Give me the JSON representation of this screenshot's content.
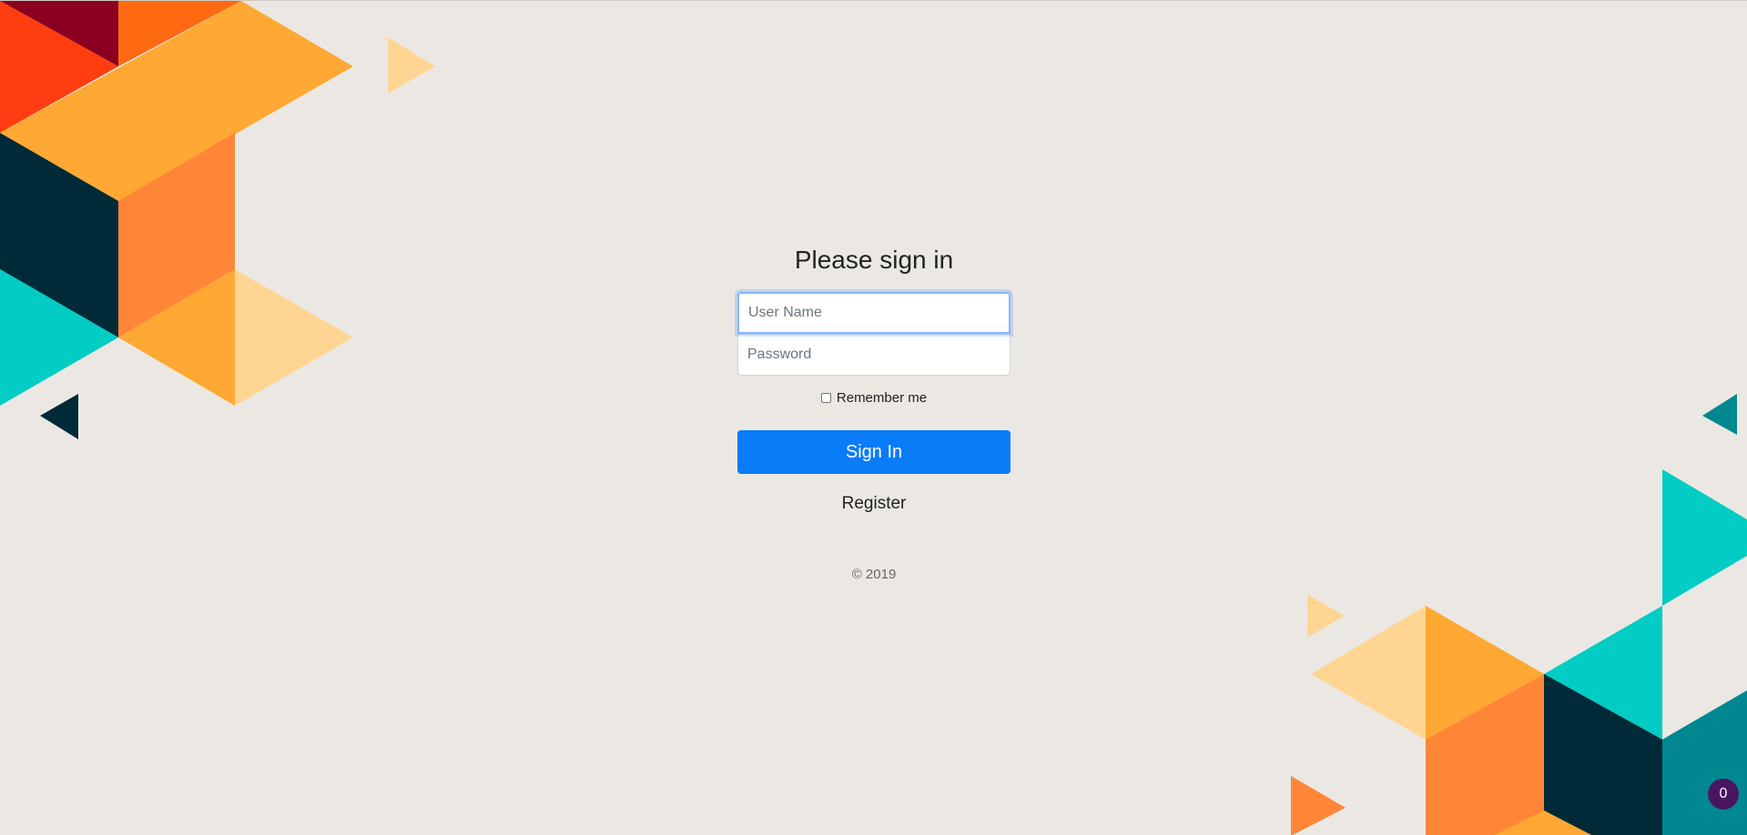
{
  "form": {
    "title": "Please sign in",
    "username_placeholder": "User Name",
    "password_placeholder": "Password",
    "remember_label": "Remember me",
    "signin_label": "Sign In",
    "register_label": "Register"
  },
  "footer": {
    "copyright": "© 2019"
  },
  "badge": {
    "count": "0"
  },
  "colors": {
    "background": "#ebe8e3",
    "primary_button": "#0a7cf7",
    "badge": "#4a1561"
  }
}
